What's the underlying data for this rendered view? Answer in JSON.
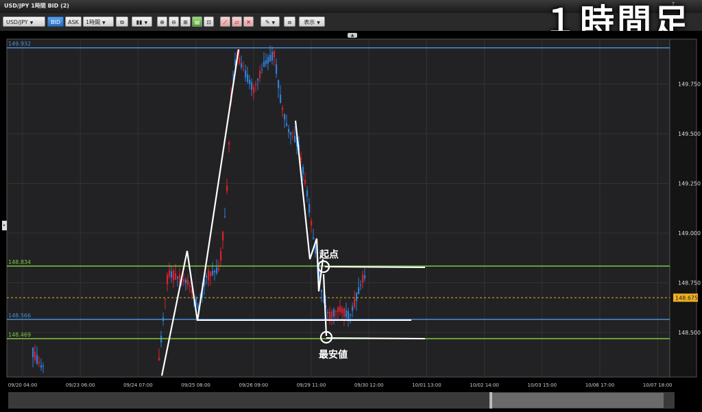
{
  "window": {
    "title": "USD/JPY 1時間 BID (2)",
    "help": "?"
  },
  "overlay_title": "１時間足",
  "toolbar": {
    "symbol": "USD/JPY",
    "bid": "BID",
    "ask": "ASK",
    "timeframe": "1時間",
    "display": "表示"
  },
  "chart_data": {
    "type": "candlestick",
    "x_tick_labels": [
      "09/20 04:00",
      "09/23 06:00",
      "09/24 07:00",
      "09/25 08:00",
      "09/26 09:00",
      "09/29 11:00",
      "09/30 12:00",
      "10/01 13:00",
      "10/02 14:00",
      "10/03 15:00",
      "10/06 17:00",
      "10/07 18:00"
    ],
    "y_tick_labels": [
      148.5,
      148.75,
      149.0,
      149.25,
      149.5,
      149.75
    ],
    "ylim": [
      148.28,
      150.02
    ],
    "current_price": 148.675,
    "horizontal_lines": [
      {
        "label": "149.932",
        "value": 149.932,
        "color": "#4a90d9"
      },
      {
        "label": "148.834",
        "value": 148.834,
        "color": "#7cc93f"
      },
      {
        "label": "148.566",
        "value": 148.566,
        "color": "#4a90d9"
      },
      {
        "label": "148.469",
        "value": 148.469,
        "color": "#7cc93f"
      }
    ],
    "annotations": [
      "起点",
      "最安値"
    ],
    "colors": {
      "up": "#e0202a",
      "down": "#2f7fd8",
      "current": "#f0b020"
    }
  }
}
